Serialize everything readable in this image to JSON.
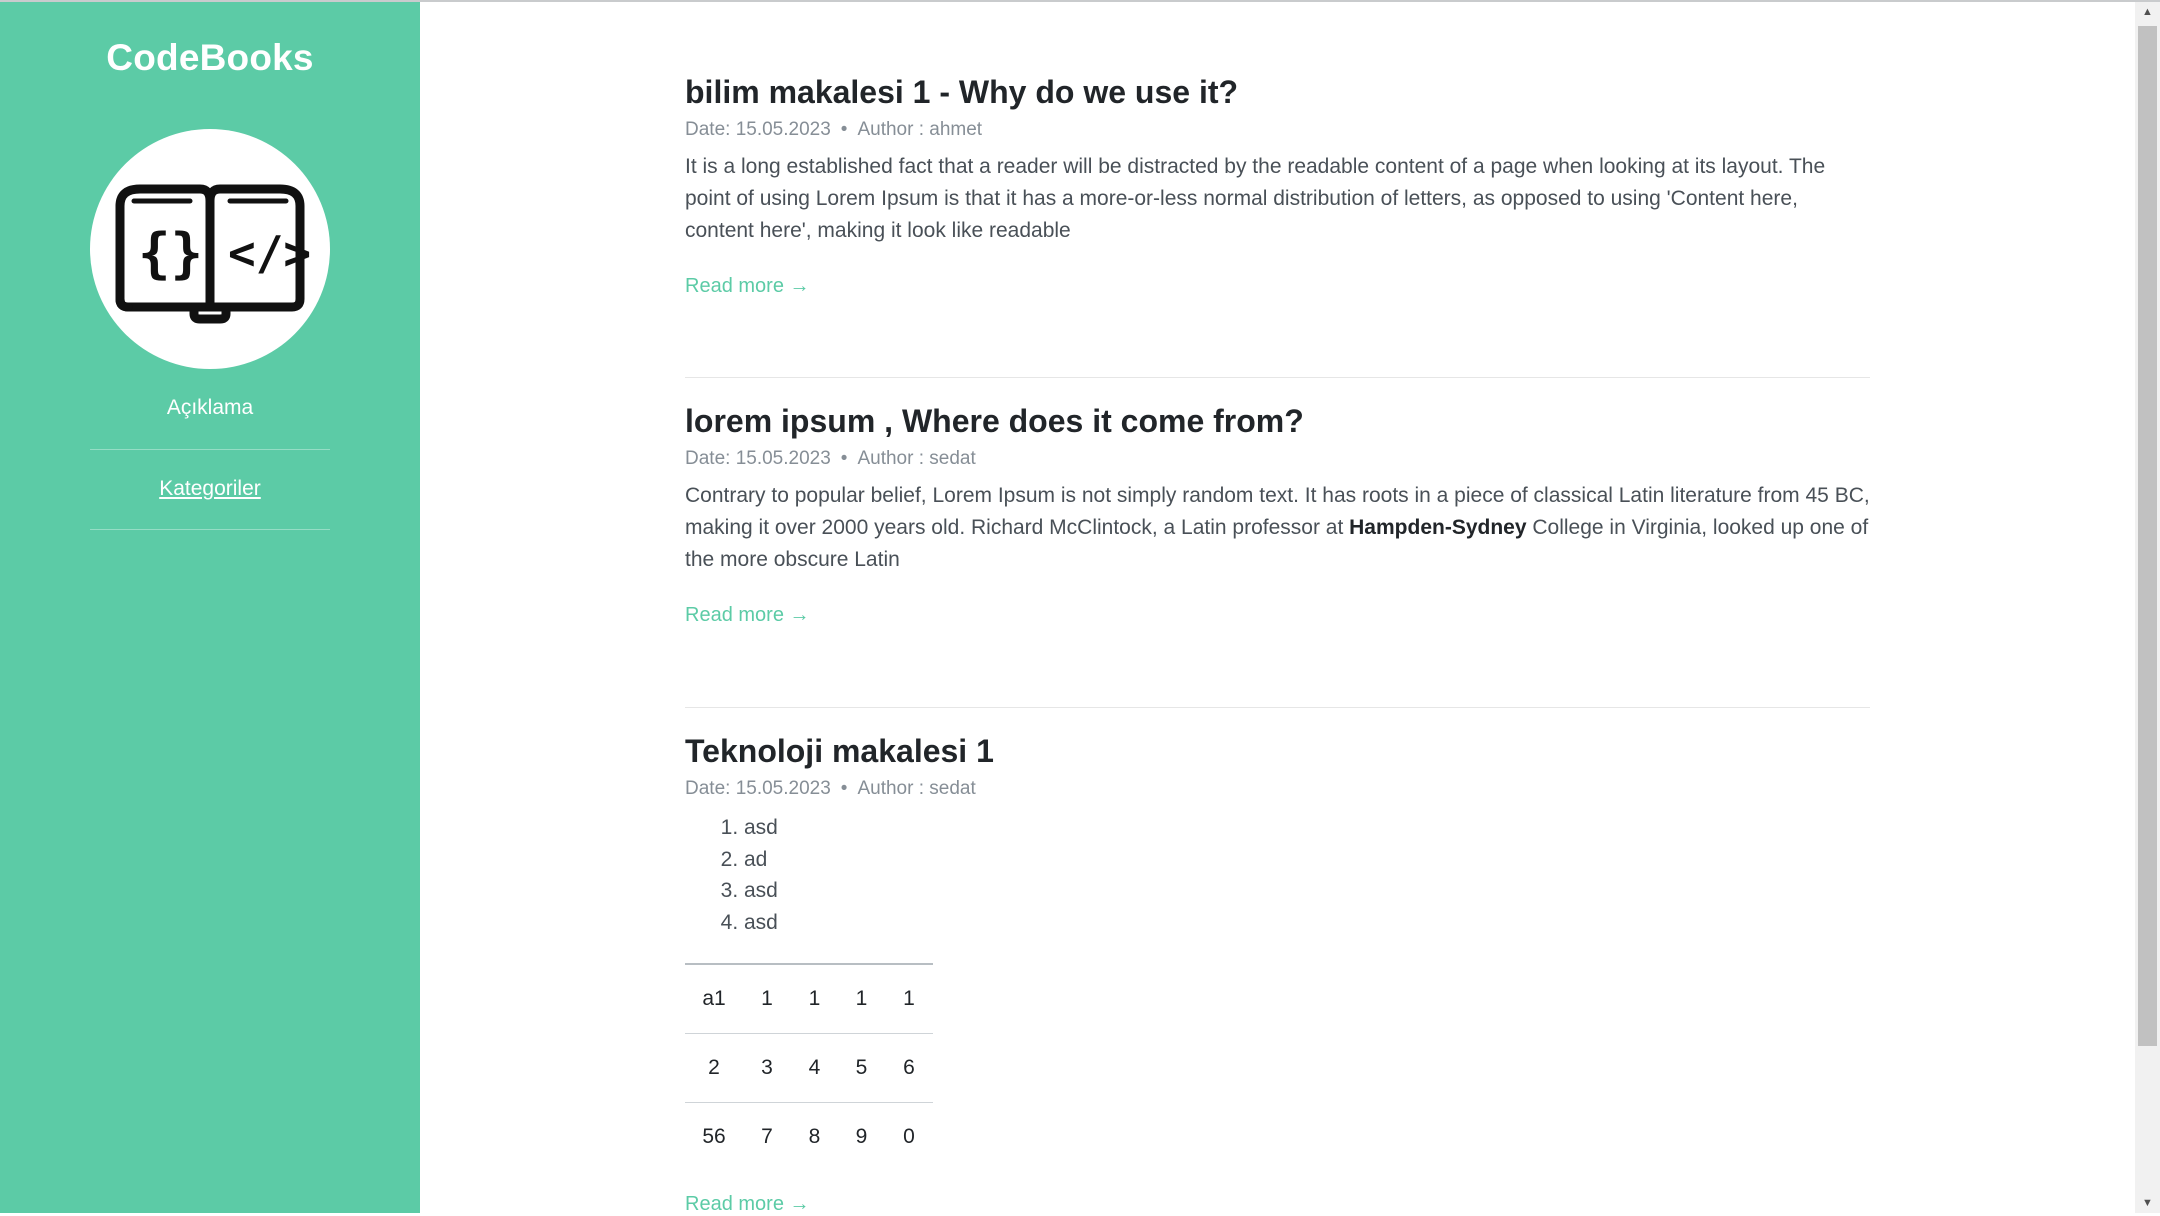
{
  "sidebar": {
    "brand": "CodeBooks",
    "logo_icon": "open-book-code-icon",
    "description": "Açıklama",
    "categories_link": "Kategoriler",
    "background_color": "#5ccba6"
  },
  "posts": [
    {
      "title": "bilim makalesi 1 - Why do we use it?",
      "date": "Date: 15.05.2023",
      "separator": "•",
      "author": "Author : ahmet",
      "excerpt": "It is a long established fact that a reader will be distracted by the readable content of a page when looking at its layout. The point of using Lorem Ipsum is that it has a more-or-less normal distribution of letters, as opposed to using 'Content here, content here', making it look like readable",
      "read_more": "Read more →"
    },
    {
      "title": "lorem ipsum , Where does it come from?",
      "date": "Date: 15.05.2023",
      "separator": "•",
      "author": "Author : sedat",
      "excerpt_before": "Contrary to popular belief, Lorem Ipsum is not simply random text. It has roots in a piece of classical Latin literature from 45 BC, making it over 2000 years old. Richard McClintock, a Latin professor at ",
      "excerpt_bold": "Hampden-Sydney",
      "excerpt_after": " College in Virginia, looked up one of the more obscure Latin",
      "read_more": "Read more →"
    },
    {
      "title": "Teknoloji makalesi 1",
      "date": "Date: 15.05.2023",
      "separator": "•",
      "author": "Author : sedat",
      "list": [
        "asd",
        "ad",
        "asd",
        "asd"
      ],
      "table": [
        [
          "a1",
          "1",
          "1",
          "1",
          "1"
        ],
        [
          "2",
          "3",
          "4",
          "5",
          "6"
        ],
        [
          "56",
          "7",
          "8",
          "9",
          "0"
        ]
      ],
      "read_more": "Read more →"
    }
  ],
  "colors": {
    "accent": "#5ccba6",
    "meta": "#868e96",
    "text": "#495057"
  }
}
